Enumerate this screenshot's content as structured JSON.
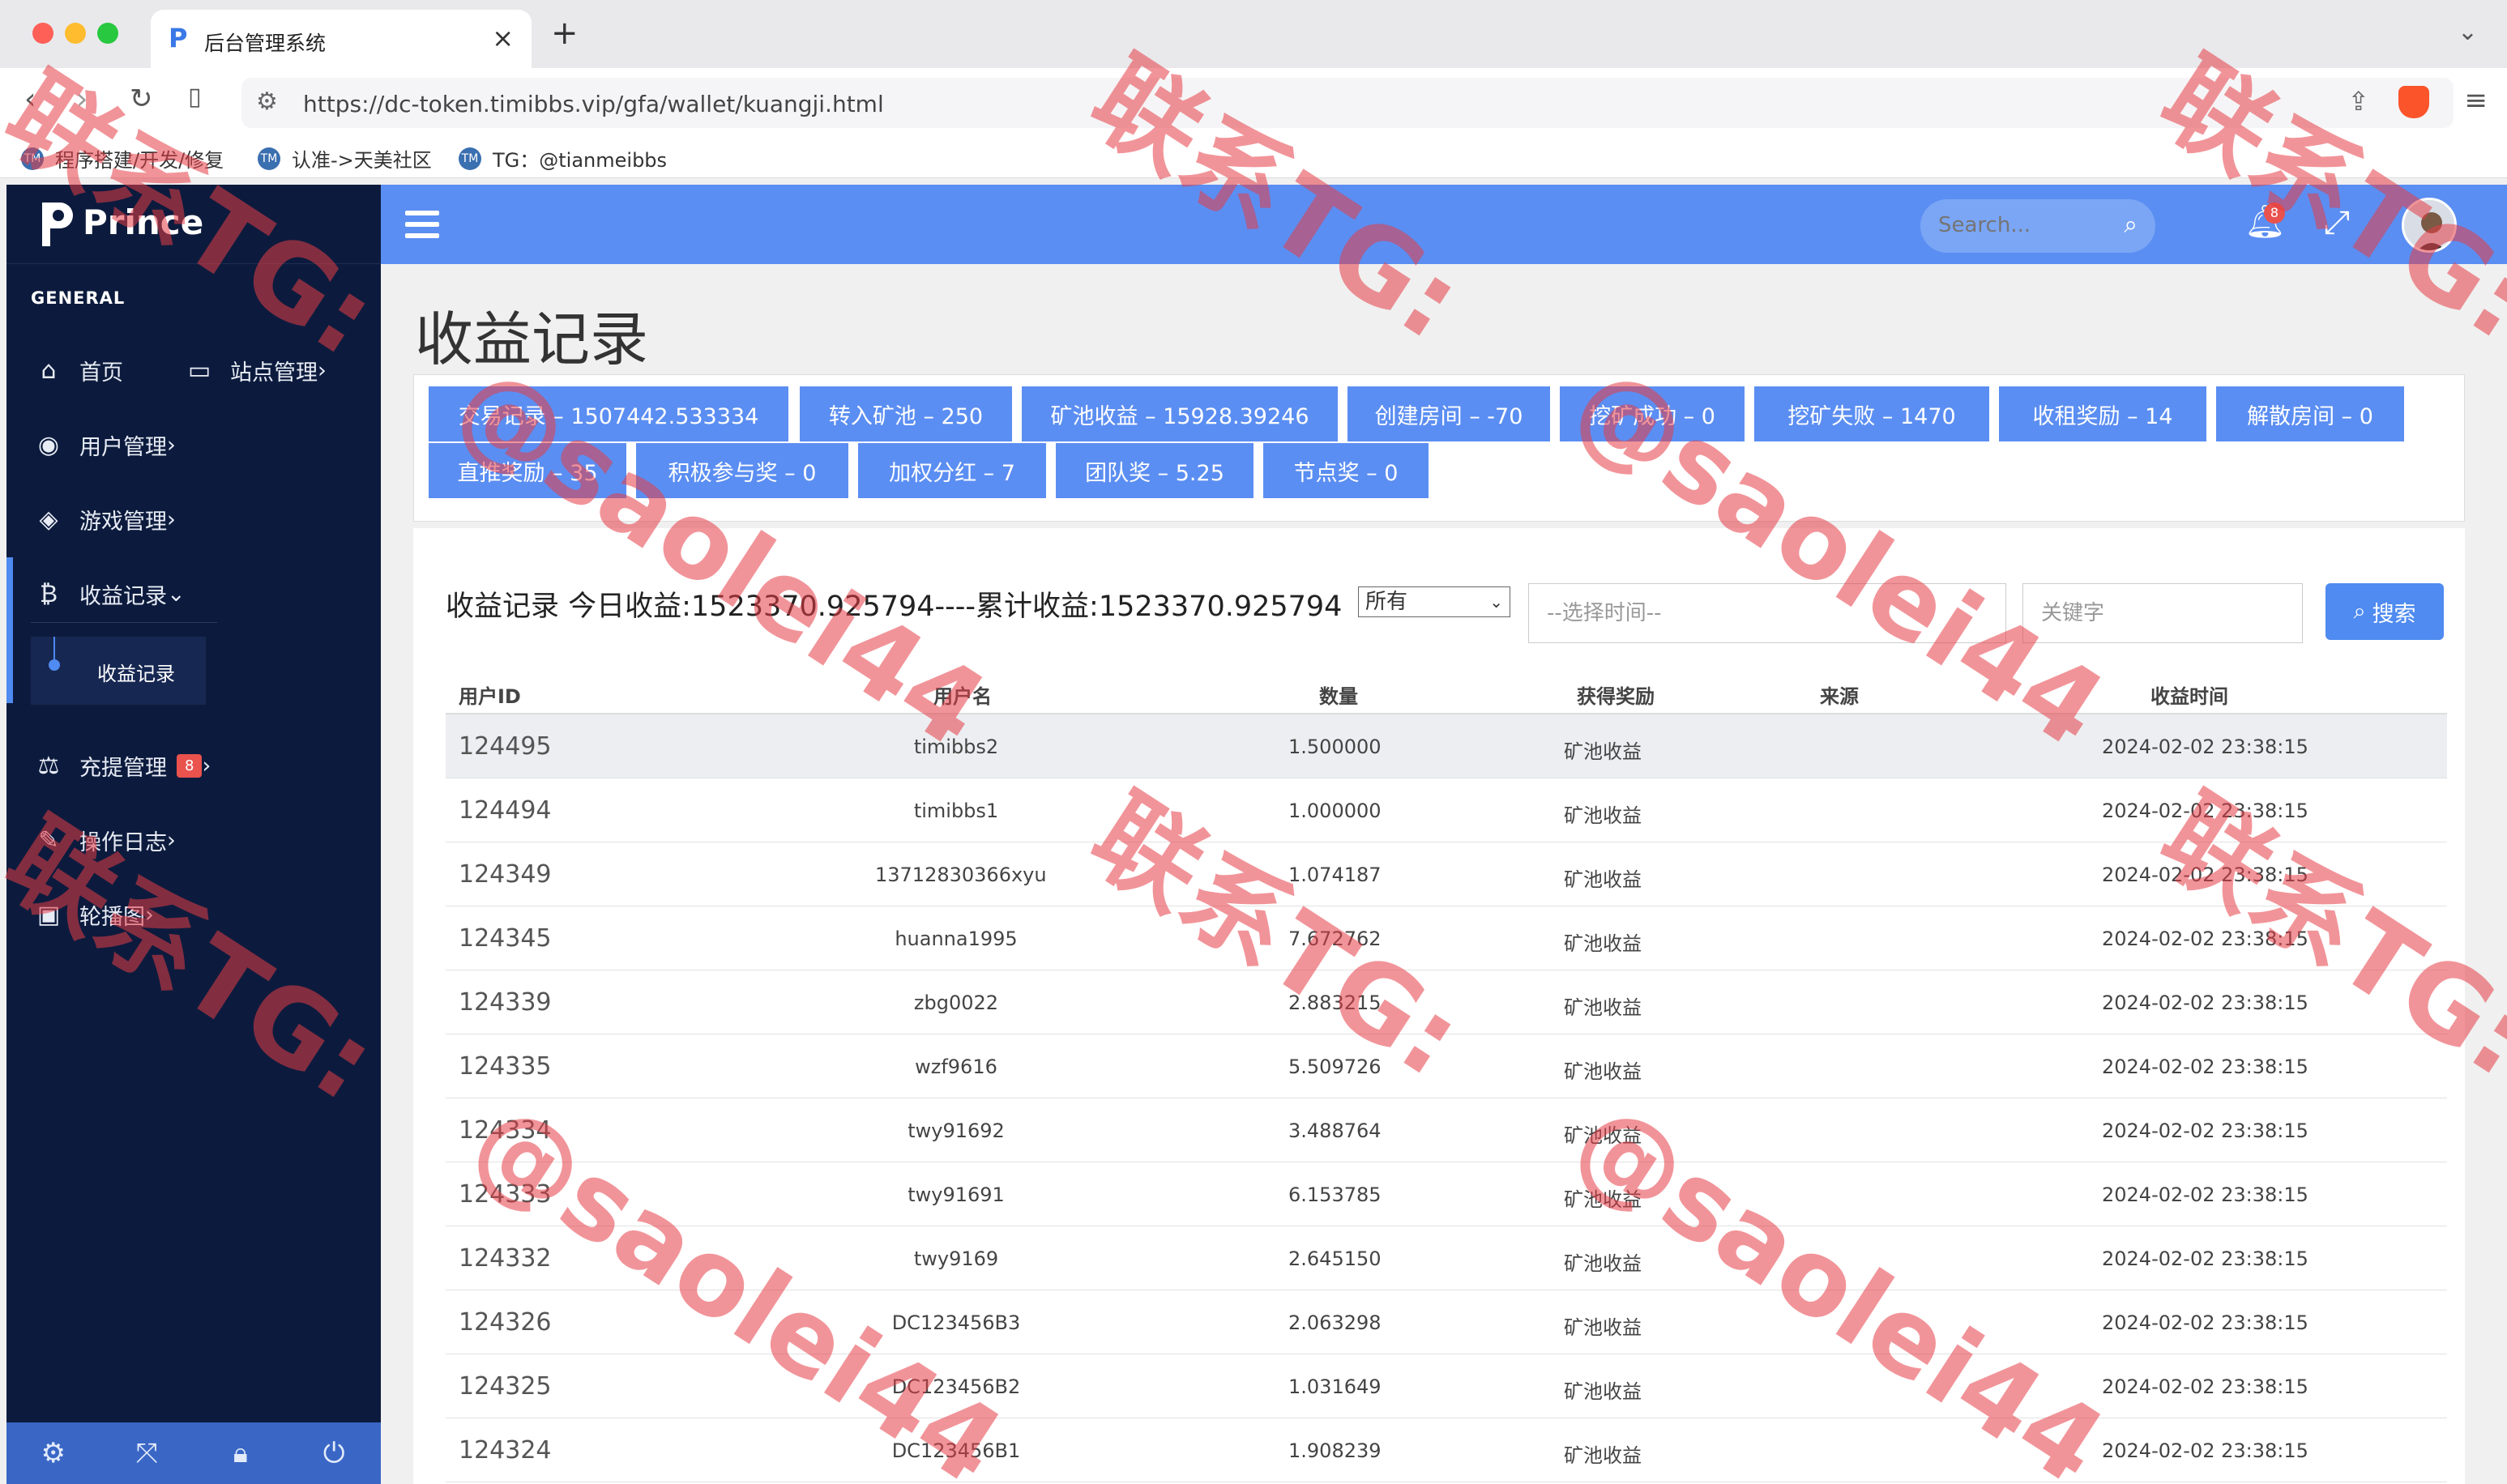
{
  "browser": {
    "tab_title": "后台管理系统",
    "url": "https://dc-token.timibbs.vip/gfa/wallet/kuangji.html",
    "bookmarks": [
      "程序搭建/开发/修复",
      "认准->天美社区",
      "TG：@tianmeibbs"
    ]
  },
  "sidebar": {
    "brand": "Prince",
    "section": "GENERAL",
    "items": [
      {
        "label": "首页",
        "icon": "home-icon"
      },
      {
        "label": "站点管理",
        "icon": "monitor-icon"
      },
      {
        "label": "用户管理",
        "icon": "user-icon"
      },
      {
        "label": "游戏管理",
        "icon": "cube-icon"
      },
      {
        "label": "收益记录",
        "icon": "bitcoin-icon"
      },
      {
        "label": "充提管理",
        "icon": "scale-icon",
        "badge": "8"
      },
      {
        "label": "操作日志",
        "icon": "edit-icon"
      },
      {
        "label": "轮播图",
        "icon": "image-icon"
      }
    ],
    "submenu_active": "收益记录"
  },
  "topbar": {
    "search_placeholder": "Search...",
    "notification_count": "8"
  },
  "page": {
    "title": "收益记录",
    "stats": [
      "交易记录 – 1507442.533334",
      "转入矿池 – 250",
      "矿池收益 – 15928.39246",
      "创建房间 – -70",
      "挖矿成功 – 0",
      "挖矿失败 – 1470",
      "收租奖励 – 14",
      "解散房间 – 0",
      "直推奖励 – 35",
      "积极参与奖 – 0",
      "加权分红 – 7",
      "团队奖 – 5.25",
      "节点奖 – 0"
    ],
    "list_heading": "收益记录 今日收益:1523370.925794----累计收益:1523370.925794",
    "filter_select": "所有",
    "time_placeholder": "--选择时间--",
    "keyword_placeholder": "关键字",
    "search_button": "搜索"
  },
  "table": {
    "columns": [
      "用户ID",
      "用户名",
      "数量",
      "获得奖励",
      "来源",
      "收益时间"
    ],
    "rows": [
      [
        "124495",
        "timibbs2",
        "1.500000",
        "矿池收益",
        "",
        "2024-02-02 23:38:15"
      ],
      [
        "124494",
        "timibbs1",
        "1.000000",
        "矿池收益",
        "",
        "2024-02-02 23:38:15"
      ],
      [
        "124349",
        "13712830366xyu",
        "1.074187",
        "矿池收益",
        "",
        "2024-02-02 23:38:15"
      ],
      [
        "124345",
        "huanna1995",
        "7.672762",
        "矿池收益",
        "",
        "2024-02-02 23:38:15"
      ],
      [
        "124339",
        "zbg0022",
        "2.883215",
        "矿池收益",
        "",
        "2024-02-02 23:38:15"
      ],
      [
        "124335",
        "wzf9616",
        "5.509726",
        "矿池收益",
        "",
        "2024-02-02 23:38:15"
      ],
      [
        "124334",
        "twy91692",
        "3.488764",
        "矿池收益",
        "",
        "2024-02-02 23:38:15"
      ],
      [
        "124333",
        "twy91691",
        "6.153785",
        "矿池收益",
        "",
        "2024-02-02 23:38:15"
      ],
      [
        "124332",
        "twy9169",
        "2.645150",
        "矿池收益",
        "",
        "2024-02-02 23:38:15"
      ],
      [
        "124326",
        "DC123456B3",
        "2.063298",
        "矿池收益",
        "",
        "2024-02-02 23:38:15"
      ],
      [
        "124325",
        "DC123456B2",
        "1.031649",
        "矿池收益",
        "",
        "2024-02-02 23:38:15"
      ],
      [
        "124324",
        "DC123456B1",
        "1.908239",
        "矿池收益",
        "",
        "2024-02-02 23:38:15"
      ]
    ]
  },
  "watermark": {
    "line1": "联系TG:",
    "line2": "@saolei44"
  },
  "colors": {
    "sidebar_bg": "#0c1b3d",
    "topbar_bg": "#5b8ef2",
    "stat_button_bg": "#5b8ef2",
    "watermark": "#e63c46"
  }
}
